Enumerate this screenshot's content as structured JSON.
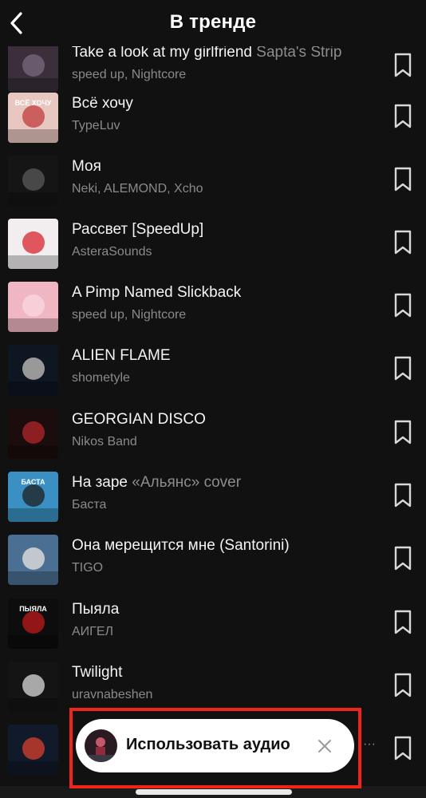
{
  "header": {
    "title": "В тренде"
  },
  "tracks": [
    {
      "title": "Take a look at my girlfriend",
      "title_extra": " Sapta's Strip",
      "artist": "speed up, Nightcore"
    },
    {
      "title": "Всё хочу",
      "title_extra": "",
      "artist": "TypeLuv"
    },
    {
      "title": "Моя",
      "title_extra": "",
      "artist": "Neki, ALEMOND, Xcho"
    },
    {
      "title": "Рассвет [SpeedUp]",
      "title_extra": "",
      "artist": "AsteraSounds"
    },
    {
      "title": "A Pimp Named Slickback",
      "title_extra": "",
      "artist": "speed up, Nightcore"
    },
    {
      "title": "ALIEN FLAME",
      "title_extra": "",
      "artist": "shometyle"
    },
    {
      "title": "GEORGIAN DISCO",
      "title_extra": "",
      "artist": "Nikos Band"
    },
    {
      "title": "На заре",
      "title_extra": " «Альянс» cover",
      "artist": "Баста"
    },
    {
      "title": "Она мерещится мне (Santorini)",
      "title_extra": "",
      "artist": "TIGO"
    },
    {
      "title": "Пыяла",
      "title_extra": "",
      "artist": "АИГЕЛ"
    },
    {
      "title": "Twilight",
      "title_extra": "",
      "artist": "uravnabeshen"
    },
    {
      "title": "",
      "title_extra": "",
      "artist": ""
    }
  ],
  "covers": [
    {
      "label": "",
      "bg": "#3a2f3a",
      "accent": "#7a6a80"
    },
    {
      "label": "ВСЁ ХОЧУ",
      "bg": "#e8c7c0",
      "accent": "#c23c3c"
    },
    {
      "label": "",
      "bg": "#151515",
      "accent": "#5a5a5a"
    },
    {
      "label": "",
      "bg": "#f2eef0",
      "accent": "#d8232f"
    },
    {
      "label": "",
      "bg": "#f0b7c3",
      "accent": "#f8d7df"
    },
    {
      "label": "",
      "bg": "#0e1622",
      "accent": "#c9c6c2"
    },
    {
      "label": "",
      "bg": "#1b0d0d",
      "accent": "#b3262a"
    },
    {
      "label": "БАСТА",
      "bg": "#3a90c2",
      "accent": "#1f1f1f"
    },
    {
      "label": "",
      "bg": "#4b6f93",
      "accent": "#e9e6e0"
    },
    {
      "label": "ПЫЯЛА",
      "bg": "#0d0d0d",
      "accent": "#c01a1a"
    },
    {
      "label": "",
      "bg": "#141414",
      "accent": "#d9d9d9"
    },
    {
      "label": "",
      "bg": "#101a2a",
      "accent": "#d83f2c"
    }
  ],
  "toast": {
    "label": "Использовать аудио"
  },
  "colors": {
    "highlight": "#f1241c",
    "background": "#111111"
  }
}
